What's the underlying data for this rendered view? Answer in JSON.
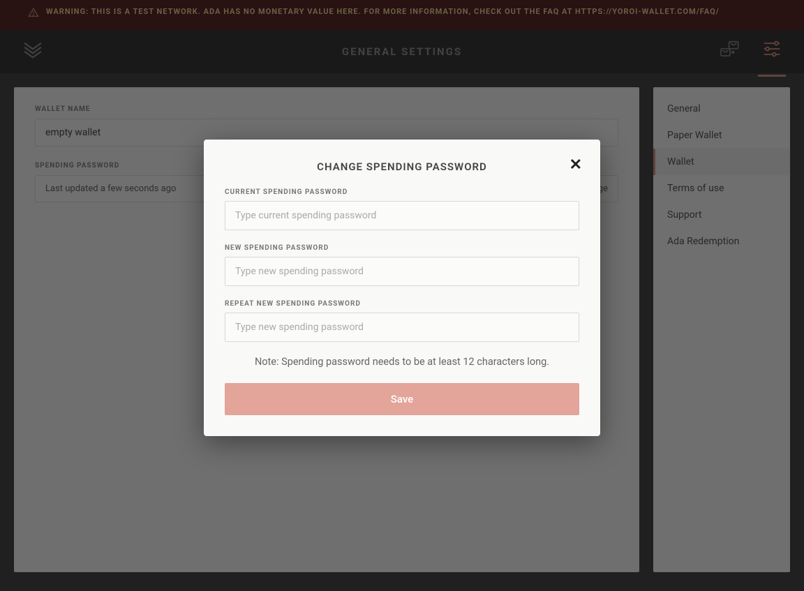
{
  "warning": {
    "text": "WARNING: THIS IS A TEST NETWORK. ADA HAS NO MONETARY VALUE HERE. FOR MORE INFORMATION, CHECK OUT THE FAQ AT HTTPS://YOROI-WALLET.COM/FAQ/"
  },
  "header": {
    "title": "GENERAL SETTINGS"
  },
  "mainContent": {
    "walletName": {
      "label": "WALLET NAME",
      "value": "empty wallet"
    },
    "spendingPassword": {
      "label": "SPENDING PASSWORD",
      "statusText": "Last updated a few seconds ago",
      "changeLink": "change"
    }
  },
  "sidebar": {
    "items": [
      {
        "label": "General",
        "active": false
      },
      {
        "label": "Paper Wallet",
        "active": false
      },
      {
        "label": "Wallet",
        "active": true
      },
      {
        "label": "Terms of use",
        "active": false
      },
      {
        "label": "Support",
        "active": false
      },
      {
        "label": "Ada Redemption",
        "active": false
      }
    ]
  },
  "modal": {
    "title": "CHANGE SPENDING PASSWORD",
    "fields": {
      "current": {
        "label": "CURRENT SPENDING PASSWORD",
        "placeholder": "Type current spending password"
      },
      "new": {
        "label": "NEW SPENDING PASSWORD",
        "placeholder": "Type new spending password"
      },
      "repeat": {
        "label": "REPEAT NEW SPENDING PASSWORD",
        "placeholder": "Type new spending password"
      }
    },
    "note": "Note: Spending password needs to be at least 12 characters long.",
    "saveLabel": "Save"
  }
}
